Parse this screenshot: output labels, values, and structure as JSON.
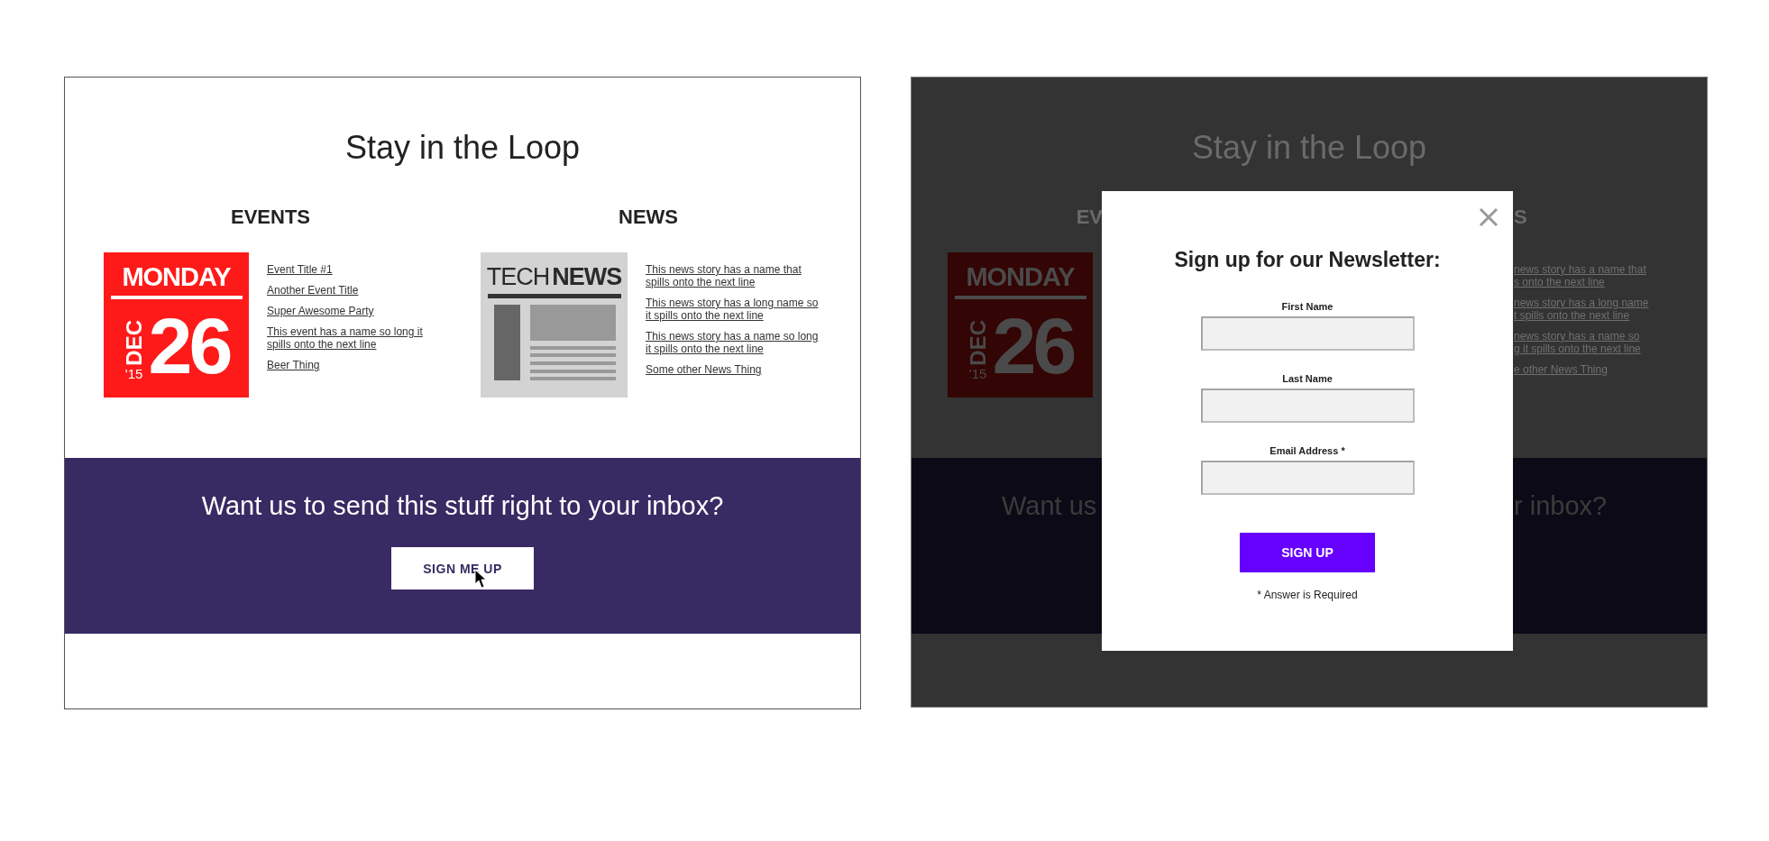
{
  "left_page": {
    "title": "Stay in the Loop",
    "events": {
      "heading": "EVENTS",
      "calendar": {
        "day": "MONDAY",
        "month": "DEC",
        "year": "'15",
        "date": "26"
      },
      "links": [
        "Event Title #1",
        "Another Event Title",
        "Super Awesome Party",
        "This event has a name so long it spills onto the next line",
        "Beer Thing"
      ]
    },
    "news": {
      "heading": "NEWS",
      "image": {
        "word_1": "TECH",
        "word_2": "NEWS"
      },
      "links": [
        "This news story has a name that spills onto the next line",
        "This news story has a long name so it spills onto the next line",
        "This news story has a name so long it spills onto the next line",
        "Some other News Thing"
      ]
    },
    "banner": {
      "text": "Want us to send this stuff right to your inbox?",
      "button": "SIGN ME UP"
    }
  },
  "right_page": {
    "title": "Stay in the Loop",
    "events_heading": "EV",
    "news_heading": "S",
    "calendar": {
      "day": "MONDAY",
      "month": "DEC",
      "year": "'15",
      "date": "26"
    },
    "news_fragments": [
      {
        "lines": [
          "news story has a name that",
          "s onto the next line"
        ]
      },
      {
        "lines": [
          "news story has a long name",
          "t spills onto the next line"
        ]
      },
      {
        "lines": [
          "news story has a name so",
          "g it spills onto the next line"
        ]
      },
      {
        "lines": [
          "e other News Thing"
        ]
      }
    ],
    "banner_left": "Want us",
    "banner_right": "r inbox?"
  },
  "modal": {
    "title": "Sign up for our Newsletter:",
    "fields": [
      {
        "label": "First Name"
      },
      {
        "label": "Last Name"
      },
      {
        "label": "Email Address *"
      }
    ],
    "button": "SIGN UP",
    "note": "* Answer is Required"
  }
}
